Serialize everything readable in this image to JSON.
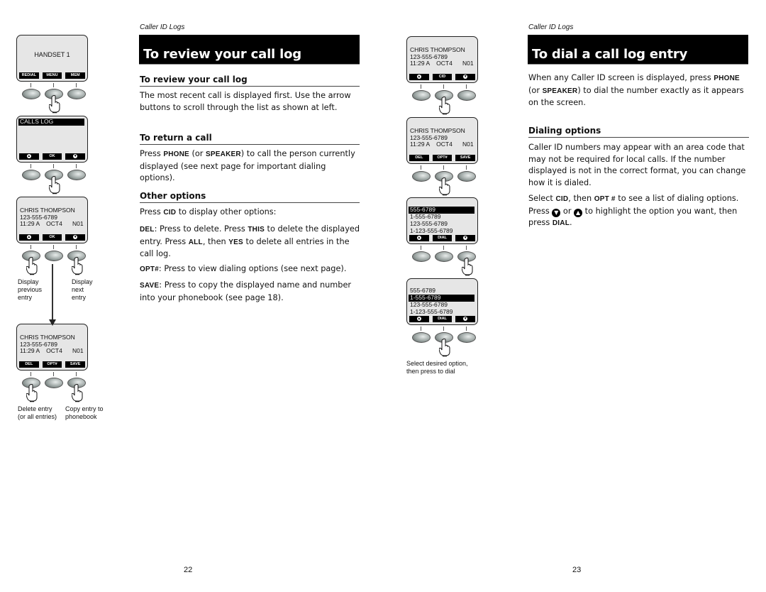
{
  "left_page": {
    "section_label": "Caller ID Logs",
    "title": "To review your call log",
    "sections": [
      {
        "heading": "To review your call log",
        "paragraphs": [
          "The most recent call is displayed first. Use the arrow buttons to scroll through the list as shown at left."
        ]
      },
      {
        "heading": "To return a call",
        "p1_a": "Press ",
        "p1_k1": "PHONE",
        "p1_b": " (or ",
        "p1_k2": "SPEAKER",
        "p1_c": ") to call the person currently displayed (see next page for important dialing options)."
      },
      {
        "heading": "Other options",
        "p1_a": "Press ",
        "p1_k1": "CID",
        "p1_b": " to display other options:",
        "del_k": "DEL",
        "del_a": ": Press to delete. Press ",
        "del_k2": "THIS",
        "del_b": " to delete the displayed entry. Press ",
        "del_k3": "ALL",
        "del_c": ", then ",
        "del_k4": "YES",
        "del_d": " to delete all entries in the call log.",
        "opt_k": "OPT#",
        "opt_a": ": Press to view dialing options (see next page).",
        "save_k": "SAVE",
        "save_a": ": Press to copy the displayed name and number into your phonebook (see page 18)."
      }
    ],
    "page_number": "22",
    "diagrams": [
      {
        "screen_center": "HANDSET 1",
        "softkeys": [
          "REDIAL",
          "MENU",
          "MEM"
        ]
      },
      {
        "highlight": "CALLS LOG",
        "softkeys": [
          "▲",
          "OK",
          "▼"
        ]
      },
      {
        "lines": [
          "CHRIS THOMPSON",
          "123-555-6789",
          "11:29 A    OCT4      N01"
        ],
        "softkeys": [
          "▲",
          "OK",
          "▼"
        ],
        "caption_left": [
          "Display",
          "previous",
          "entry"
        ],
        "caption_right": [
          "Display",
          "next",
          "entry"
        ]
      },
      {
        "lines": [
          "CHRIS THOMPSON",
          "123-555-6789",
          "11:29 A    OCT4      N01"
        ],
        "softkeys": [
          "DEL",
          "OPT#",
          "SAVE"
        ],
        "caption_left": [
          "Delete entry",
          "(or all entries)"
        ],
        "caption_right": [
          "Copy entry to",
          "phonebook"
        ]
      }
    ]
  },
  "right_page": {
    "section_label": "Caller ID Logs",
    "title": "To dial a call log entry",
    "intro_a": "When any Caller ID screen is displayed, press ",
    "intro_k1": "PHONE",
    "intro_b": " (or ",
    "intro_k2": "SPEAKER",
    "intro_c": ") to dial the number exactly as it appears on the screen.",
    "dialing_heading": "Dialing options",
    "dialing_p1": "Caller ID numbers may appear with an area code that may not be required for local calls. If the number displayed is not in the correct format, you can change how it is dialed.",
    "dialing_p2_a": "Select ",
    "dialing_p2_k1": "CID",
    "dialing_p2_b": ", then ",
    "dialing_p2_k2": "OPT #",
    "dialing_p2_c": " to see a list of dialing options. Press ",
    "dialing_p2_icon1": "▼",
    "dialing_p2_d": " or ",
    "dialing_p2_icon2": "▲",
    "dialing_p2_e": " to highlight the option you want, then press ",
    "dialing_p2_k3": "DIAL",
    "dialing_p2_f": ".",
    "page_number": "23",
    "diagrams": [
      {
        "lines": [
          "CHRIS THOMPSON",
          "123-555-6789",
          "11:29 A    OCT4      N01"
        ],
        "softkeys": [
          "▲",
          "CID",
          "▼"
        ]
      },
      {
        "lines": [
          "CHRIS THOMPSON",
          "123-555-6789",
          "11:29 A    OCT4      N01"
        ],
        "softkeys": [
          "DEL",
          "OPT#",
          "SAVE"
        ]
      },
      {
        "options": [
          "555-6789",
          "1-555-6789",
          "123-555-6789",
          "1-123-555-6789"
        ],
        "selected": 0,
        "softkeys": [
          "▲",
          "DIAL",
          "▼"
        ]
      },
      {
        "options": [
          "555-6789",
          "1-555-6789",
          "123-555-6789",
          "1-123-555-6789"
        ],
        "selected": 1,
        "softkeys": [
          "▲",
          "DIAL",
          "▼"
        ],
        "caption": [
          "Select desired option,",
          "then press to dial"
        ]
      }
    ]
  }
}
